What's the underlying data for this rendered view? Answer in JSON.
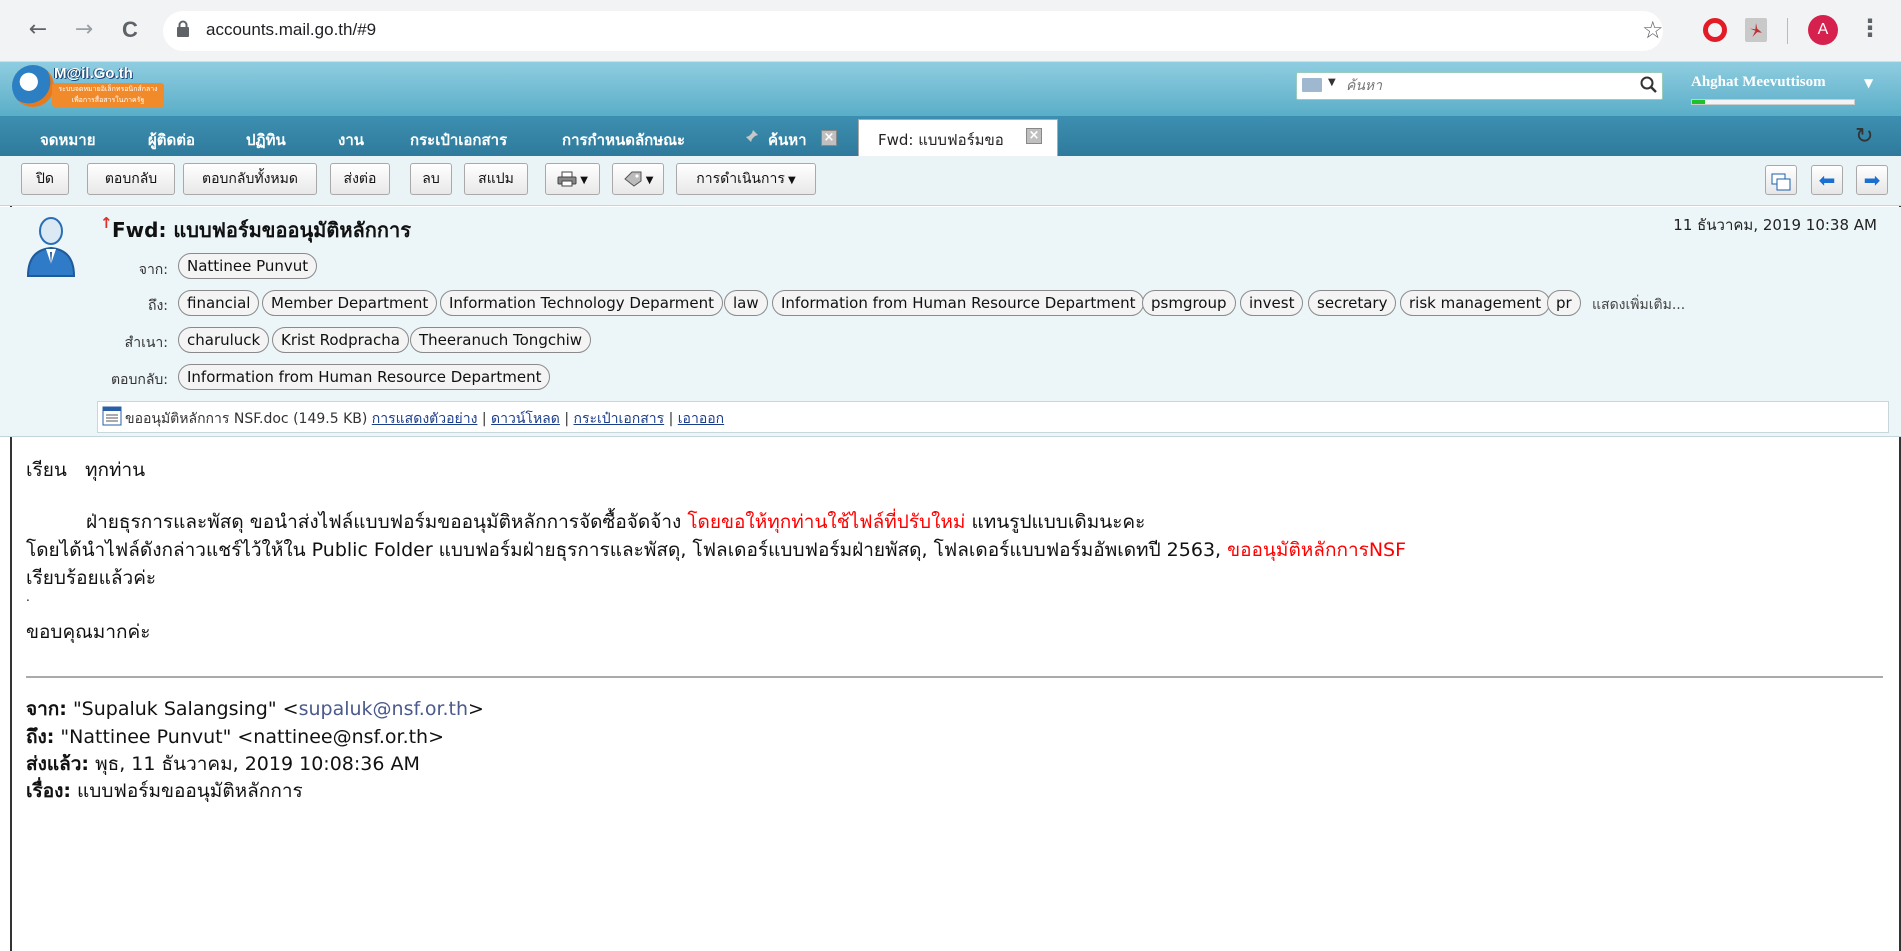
{
  "browser": {
    "url": "accounts.mail.go.th/#9",
    "back": "←",
    "forward": "→",
    "reload": "C",
    "star": "☆",
    "avatar_letter": "A",
    "menu": "⋮"
  },
  "brand": {
    "logo_title": "M@il.Go.th",
    "logo_sub": "ระบบจดหมายอิเล็กทรอนิกส์กลาง เพื่อการสื่อสารในภาครัฐ"
  },
  "header": {
    "search_placeholder": "ค้นหา",
    "user_name": "Ahghat Meevuttisom",
    "quota_fraction": 0.08
  },
  "tabs": [
    {
      "label": "จดหมาย"
    },
    {
      "label": "ผู้ติดต่อ"
    },
    {
      "label": "ปฏิทิน"
    },
    {
      "label": "งาน"
    },
    {
      "label": "กระเป๋าเอกสาร"
    },
    {
      "label": "การกำหนดลักษณะ"
    },
    {
      "label": "ค้นหา"
    }
  ],
  "active_tab": {
    "label": "Fwd: แบบฟอร์มขอ"
  },
  "toolbar": {
    "close": "ปิด",
    "reply": "ตอบกลับ",
    "reply_all": "ตอบกลับทั้งหมด",
    "forward": "ส่งต่อ",
    "delete": "ลบ",
    "spam": "สแปม",
    "actions": "การดำเนินการ"
  },
  "message": {
    "subject": "Fwd: แบบฟอร์มขออนุมัติหลักการ",
    "date": "11 ธันวาคม, 2019 10:38 AM",
    "labels": {
      "from": "จาก:",
      "to": "ถึง:",
      "cc": "สำเนา:",
      "reply_to": "ตอบกลับ:"
    },
    "from": [
      "Nattinee Punvut"
    ],
    "to": [
      "financial",
      "Member Department",
      "Information Technology Deparment",
      "law",
      "Information from Human Resource Department",
      "psmgroup",
      "invest",
      "secretary",
      "risk management",
      "pr"
    ],
    "to_more": "แสดงเพิ่มเติม...",
    "cc": [
      "charuluck",
      "Krist Rodpracha",
      "Theeranuch Tongchiw"
    ],
    "reply_to": [
      "Information from Human Resource Department"
    ],
    "attachment": {
      "name": "ขออนุมัติหลักการ NSF.doc",
      "size": "(149.5 KB)",
      "preview": "การแสดงตัวอย่าง",
      "download": "ดาวน์โหลด",
      "briefcase": "กระเป๋าเอกสาร",
      "remove": "เอาออก",
      "sep": "|"
    }
  },
  "body": {
    "greeting": "เรียน   ทุกท่าน",
    "p1_a": "ฝ่ายธุรการและพัสดุ ขอนำส่งไฟล์แบบฟอร์มขออนุมัติหลักการจัดซื้อจัดจ้าง ",
    "p1_red": "โดยขอให้ทุกท่านใช้ไฟล์ที่ปรับใหม่",
    "p1_b": " แทนรูปแบบเดิมนะคะ",
    "p2_a": "โดยได้นำไฟล์ดังกล่าวแชร์ไว้ให้ใน Public Folder แบบฟอร์มฝ่ายธุรการและพัสดุ, โฟลเดอร์แบบฟอร์มฝ่ายพัสดุ, โฟลเดอร์แบบฟอร์มอัพเดทปี 2563, ",
    "p2_red": "ขออนุมัติหลักการNSF",
    "p3": "เรียบร้อยแล้วค่ะ",
    "dot": ".",
    "thanks": "ขอบคุณมากค่ะ"
  },
  "forwarded": {
    "from_label": "จาก:",
    "from_name": " \"Supaluk Salangsing\" <",
    "from_email": "supaluk@nsf.or.th",
    "from_end": ">",
    "to_label": "ถึง:",
    "to_value": " \"Nattinee Punvut\" <nattinee@nsf.or.th>",
    "sent_label": "ส่งแล้ว:",
    "sent_value": " พุธ, 11 ธันวาคม, 2019 10:08:36 AM",
    "subject_label": "เรื่อง:",
    "subject_value": " แบบฟอร์มขออนุมัติหลักการ"
  }
}
